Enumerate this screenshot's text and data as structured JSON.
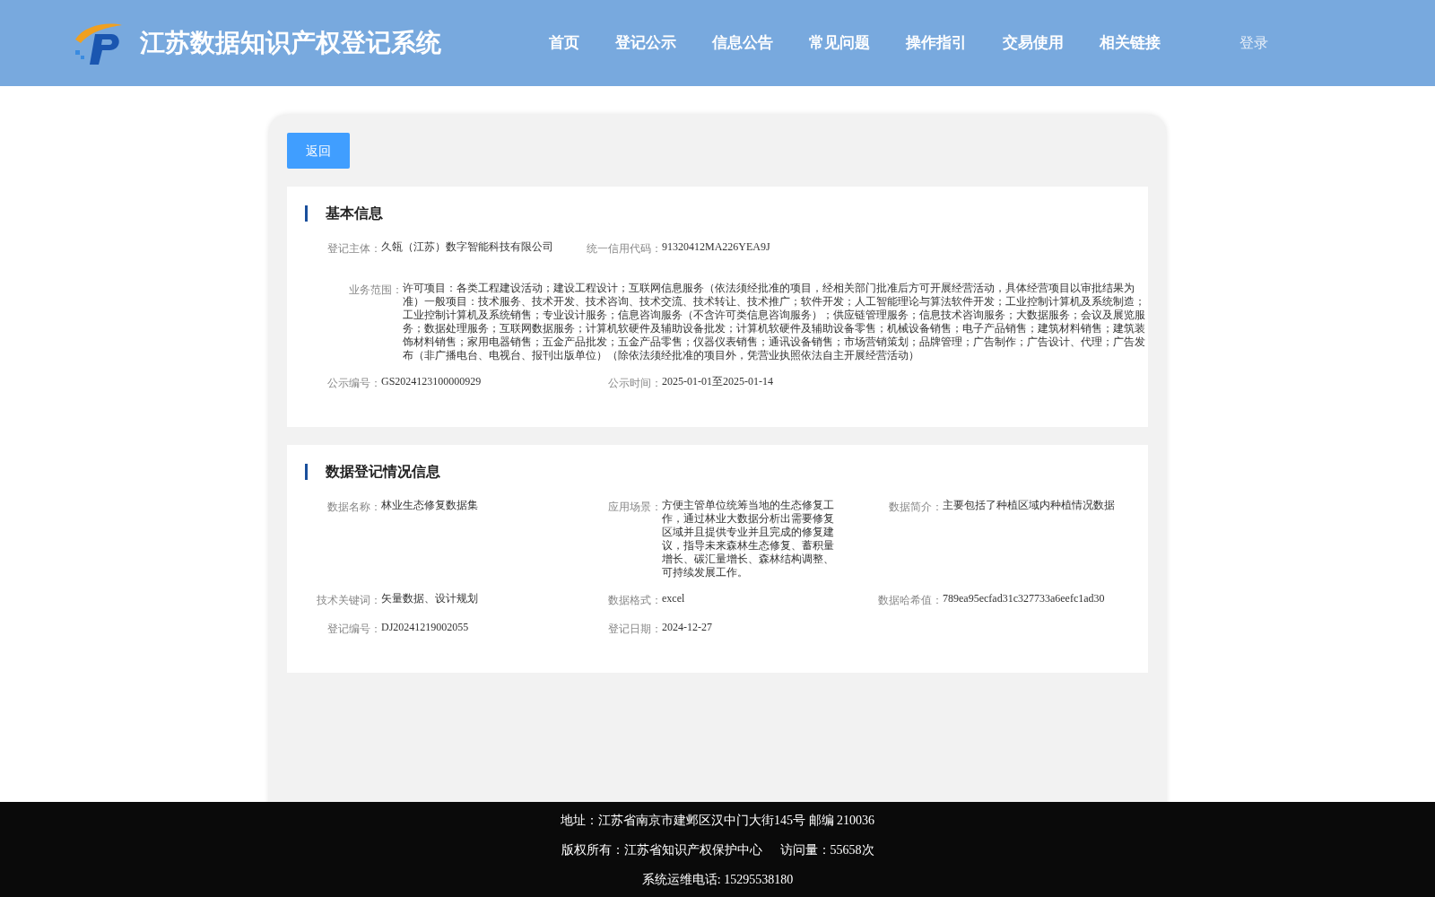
{
  "header": {
    "title": "江苏数据知识产权登记系统",
    "nav": [
      "首页",
      "登记公示",
      "信息公告",
      "常见问题",
      "操作指引",
      "交易使用",
      "相关链接"
    ],
    "login": "登录"
  },
  "back_button": "返回",
  "sections": [
    {
      "title": "基本信息",
      "fields": [
        {
          "kind": "normal",
          "label": "登记主体：",
          "value": "久瓴（江苏）数字智能科技有限公司"
        },
        {
          "kind": "normal",
          "label": "统一信用代码：",
          "value": "91320412MA226YEA9J"
        },
        {
          "kind": "break"
        },
        {
          "kind": "wide",
          "label": "业务范围：",
          "value": "许可项目：各类工程建设活动；建设工程设计；互联网信息服务（依法须经批准的项目，经相关部门批准后方可开展经营活动，具体经营项目以审批结果为准）一般项目：技术服务、技术开发、技术咨询、技术交流、技术转让、技术推广；软件开发；人工智能理论与算法软件开发；工业控制计算机及系统制造；工业控制计算机及系统销售；专业设计服务；信息咨询服务（不含许可类信息咨询服务）；供应链管理服务；信息技术咨询服务；大数据服务；会议及展览服务；数据处理服务；互联网数据服务；计算机软硬件及辅助设备批发；计算机软硬件及辅助设备零售；机械设备销售；电子产品销售；建筑材料销售；建筑装饰材料销售；家用电器销售；五金产品批发；五金产品零售；仪器仪表销售；通讯设备销售；市场营销策划；品牌管理；广告制作；广告设计、代理；广告发布（非广播电台、电视台、报刊出版单位）（除依法须经批准的项目外，凭营业执照依法自主开展经营活动）"
        },
        {
          "kind": "normal",
          "label": "公示编号：",
          "value": "GS2024123100000929"
        },
        {
          "kind": "normal",
          "label": "公示时间：",
          "value": "2025-01-01至2025-01-14"
        }
      ]
    },
    {
      "title": "数据登记情况信息",
      "fields": [
        {
          "kind": "normal",
          "label": "数据名称：",
          "value": "林业生态修复数据集"
        },
        {
          "kind": "normal",
          "label": "应用场景：",
          "value": "方便主管单位统筹当地的生态修复工作，通过林业大数据分析出需要修复区域并且提供专业并且完成的修复建议，指导未来森林生态修复、蓄积量增长、碳汇量增长、森林结构调整、可持续发展工作。"
        },
        {
          "kind": "normal",
          "label": "数据简介：",
          "value": "主要包括了种植区域内种植情况数据"
        },
        {
          "kind": "normal",
          "label": "技术关键词：",
          "value": "矢量数据、设计规划"
        },
        {
          "kind": "normal",
          "label": "数据格式：",
          "value": "excel"
        },
        {
          "kind": "normal",
          "label": "数据哈希值：",
          "value": "789ea95ecfad31c327733a6eefc1ad30"
        },
        {
          "kind": "normal",
          "label": "登记编号：",
          "value": "DJ20241219002055"
        },
        {
          "kind": "normal",
          "label": "登记日期：",
          "value": "2024-12-27"
        }
      ]
    }
  ],
  "footer": [
    "地址：江苏省南京市建邺区汉中门大街145号 邮编 210036",
    "版权所有：江苏省知识产权保护中心",
    "访问量：55658次",
    "系统运维电话: 15295538180"
  ]
}
